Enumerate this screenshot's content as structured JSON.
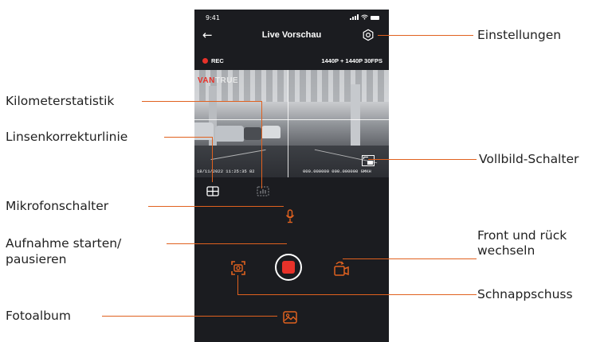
{
  "status_bar": {
    "time": "9:41"
  },
  "nav": {
    "back_glyph": "←",
    "title": "Live Vorschau",
    "settings_icon": "gear-icon"
  },
  "recording": {
    "indicator": "REC",
    "resolution": "1440P + 1440P 30FPS"
  },
  "preview": {
    "brand_left": "VAN",
    "brand_right": "TRUE",
    "osd_left": "18/11/2022 11:25:35 82",
    "osd_right": "000.000000  000.000000 GMKH"
  },
  "controls": {
    "lens_grid_icon": "grid-icon",
    "mileage_icon": "chart-icon",
    "mic_icon": "microphone-icon",
    "snapshot_icon": "camera-frame-icon",
    "record_icon": "record-stop-icon",
    "switch_icon": "camera-switch-icon",
    "album_icon": "image-icon"
  },
  "annotations": {
    "settings": "Einstellungen",
    "mileage": "Kilometerstatistik",
    "lens_line": "Linsenkorrekturlinie",
    "fullscreen": "Vollbild-Schalter",
    "mic": "Mikrofonschalter",
    "record_1": "Aufnahme starten/",
    "record_2": "pausieren",
    "switch_1": "Front und rück",
    "switch_2": "wechseln",
    "snapshot": "Schnappschuss",
    "album": "Fotoalbum"
  },
  "colors": {
    "accent": "#e0611f",
    "record_red": "#e8322a",
    "phone_bg": "#1b1c20"
  }
}
